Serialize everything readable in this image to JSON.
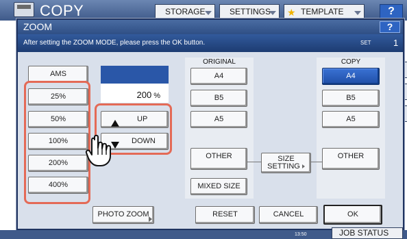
{
  "app": {
    "title": "COPY",
    "top_tabs": [
      {
        "label": "STORAGE"
      },
      {
        "label": "SETTINGS"
      },
      {
        "label": "TEMPLATE"
      }
    ],
    "help_label": "?"
  },
  "dialog": {
    "title": "ZOOM",
    "help_label": "?",
    "message": "After setting the ZOOM MODE, please press the OK button.",
    "set_label": "SET",
    "set_count": "1"
  },
  "zoom": {
    "ams_label": "AMS",
    "presets": [
      "25%",
      "50%",
      "100%",
      "200%",
      "400%"
    ],
    "value": "200",
    "unit": "%",
    "up_label": "UP",
    "down_label": "DOWN"
  },
  "original": {
    "header": "ORIGINAL",
    "sizes": [
      "A4",
      "B5",
      "A5"
    ],
    "other_label": "OTHER",
    "mixed_label": "MIXED SIZE"
  },
  "size_setting": {
    "line1": "SIZE",
    "line2": "SETTING"
  },
  "copy": {
    "header": "COPY",
    "sizes": [
      "A4",
      "B5",
      "A5"
    ],
    "selected": "A4",
    "other_label": "OTHER"
  },
  "footer": {
    "photo_zoom": "PHOTO ZOOM",
    "reset": "RESET",
    "cancel": "CANCEL",
    "ok": "OK"
  },
  "status": {
    "time": "13:50",
    "job_status": "JOB STATUS"
  },
  "colors": {
    "accent": "#2a57a8",
    "highlight": "#e46a56",
    "selected": "#1f4ea6"
  }
}
